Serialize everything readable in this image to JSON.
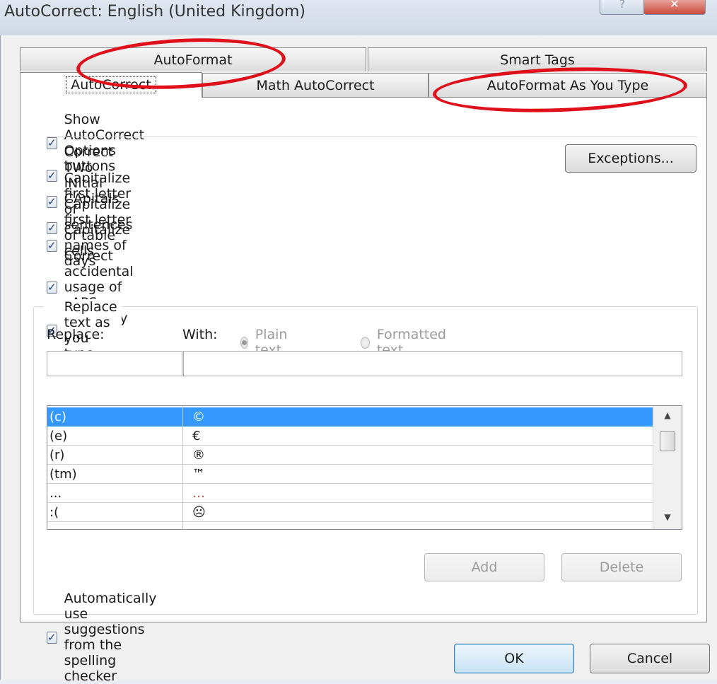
{
  "window": {
    "title": "AutoCorrect: English (United Kingdom)",
    "help_glyph": "?",
    "close_glyph": "✕"
  },
  "tabs": {
    "row1": [
      "AutoFormat",
      "Smart Tags"
    ],
    "row2": [
      "AutoCorrect",
      "Math AutoCorrect",
      "AutoFormat As You Type"
    ],
    "active": "AutoCorrect"
  },
  "options": {
    "show_buttons": "Show AutoCorrect Options buttons",
    "two_initials": "Correct TWo INitial CApitals",
    "cap_sentences": "Capitalize first letter of sentences",
    "cap_table_cells": "Capitalize first letter of table cells",
    "cap_days": "Capitalize names of days",
    "caps_lock": "Correct accidental usage of cAPS LOCK key",
    "exceptions_button": "Exceptions...",
    "check_mark": "✓"
  },
  "replace": {
    "group_label": "Replace text as you type",
    "replace_label": "Replace:",
    "with_label": "With:",
    "plain_text": "Plain text",
    "formatted_text": "Formatted text",
    "replace_value": "",
    "with_value": "",
    "entries": [
      {
        "replace": "(c)",
        "with": "©",
        "selected": true
      },
      {
        "replace": "(e)",
        "with": "€",
        "selected": false
      },
      {
        "replace": "(r)",
        "with": "®",
        "selected": false
      },
      {
        "replace": "(tm)",
        "with": "™",
        "selected": false
      },
      {
        "replace": "...",
        "with": "…",
        "selected": false
      },
      {
        "replace": ":(",
        "with": "☹",
        "selected": false
      }
    ],
    "add_button": "Add",
    "delete_button": "Delete",
    "spelling_suggestions": "Automatically use suggestions from the spelling checker"
  },
  "footer": {
    "ok": "OK",
    "cancel": "Cancel"
  },
  "annotation": {
    "color": "#e0101a",
    "highlighted_tabs": [
      "AutoFormat",
      "AutoFormat As You Type"
    ]
  }
}
